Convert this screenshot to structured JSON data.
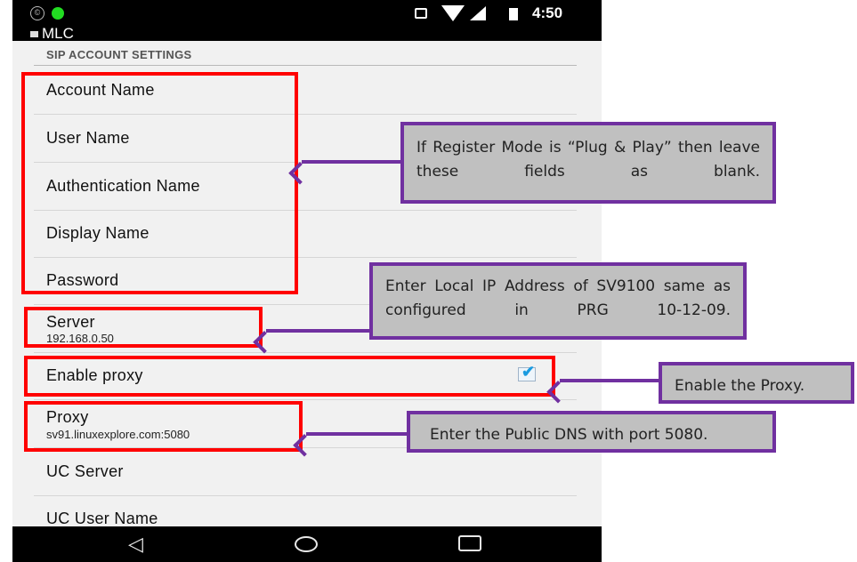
{
  "status_bar": {
    "time": "4:50"
  },
  "app_bar": {
    "title": "MLC"
  },
  "settings": {
    "section_title": "SIP ACCOUNT SETTINGS",
    "account_name": "Account Name",
    "user_name": "User Name",
    "authentication_name": "Authentication Name",
    "display_name": "Display Name",
    "password": "Password",
    "server_label": "Server",
    "server_value": "192.168.0.50",
    "enable_proxy_label": "Enable proxy",
    "enable_proxy_checked": true,
    "proxy_label": "Proxy",
    "proxy_value": "sv91.linuxexplore.com:5080",
    "uc_server": "UC Server",
    "uc_user_name": "UC User Name"
  },
  "annotations": {
    "register_mode_note": "If Register Mode is “Plug & Play” then leave these fields as blank.",
    "server_note": "Enter Local IP Address of SV9100 same as configured in PRG 10-12-09.",
    "proxy_enable_note": "Enable the Proxy.",
    "proxy_dns_note": "Enter the Public DNS with port 5080."
  },
  "colors": {
    "highlight_box": "#ff0000",
    "callout_border": "#7030a0",
    "callout_fill": "#c0c0c0",
    "checkbox_accent": "#1a9be0"
  }
}
